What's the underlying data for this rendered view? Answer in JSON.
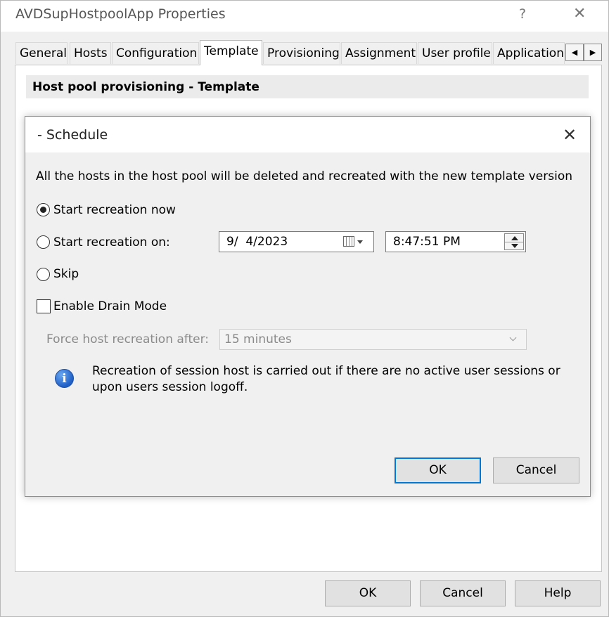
{
  "window": {
    "title": "AVDSupHostpoolApp Properties",
    "help_glyph": "?",
    "close_glyph": "✕"
  },
  "tabs": [
    {
      "label": "General"
    },
    {
      "label": "Hosts"
    },
    {
      "label": "Configuration"
    },
    {
      "label": "Template",
      "active": true
    },
    {
      "label": "Provisioning"
    },
    {
      "label": "Assignment"
    },
    {
      "label": "User profile"
    },
    {
      "label": "Application"
    }
  ],
  "tab_scroll": {
    "left_glyph": "◀",
    "right_glyph": "▶"
  },
  "section_header": "Host pool provisioning - Template",
  "dialog": {
    "title": "- Schedule",
    "close_glyph": "✕",
    "description": "All the hosts in the host pool will be deleted and recreated with the new template version",
    "options": {
      "now": {
        "label": "Start recreation now",
        "selected": true
      },
      "on": {
        "label": "Start recreation on:",
        "selected": false
      },
      "skip": {
        "label": "Skip",
        "selected": false
      }
    },
    "date_value": "9/  4/2023",
    "time_value": "8:47:51 PM",
    "drain_mode": {
      "label": "Enable Drain Mode",
      "checked": false
    },
    "force": {
      "label": "Force host recreation after:",
      "value": "15 minutes"
    },
    "info_glyph": "i",
    "info_line1": "Recreation of session host is carried out if there are no active user sessions or",
    "info_line2": "upon users session logoff.",
    "ok_label": "OK",
    "cancel_label": "Cancel"
  },
  "footer": {
    "ok_label": "OK",
    "cancel_label": "Cancel",
    "help_label": "Help"
  },
  "colors": {
    "accent": "#0078d7",
    "window_bg": "#f0f0f0"
  }
}
